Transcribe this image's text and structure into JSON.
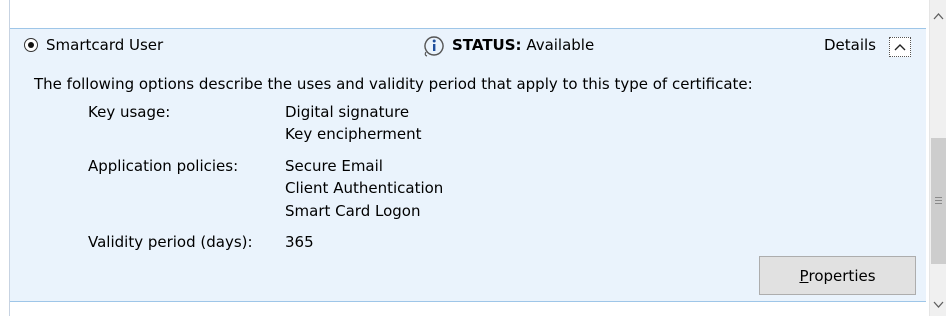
{
  "template": {
    "name": "Smartcard User",
    "status_label": "STATUS:",
    "status_value": "Available",
    "details_label": "Details",
    "description": "The following options describe the uses and validity period that apply to this type of certificate:",
    "key_usage_label": "Key usage:",
    "key_usage_values": [
      "Digital signature",
      "Key encipherment"
    ],
    "app_policies_label": "Application policies:",
    "app_policies_values": [
      "Secure Email",
      "Client Authentication",
      "Smart Card Logon"
    ],
    "validity_label": "Validity period (days):",
    "validity_value": "365",
    "properties_button": {
      "accelerator": "P",
      "rest": "roperties"
    }
  },
  "icons": {
    "status": "info-icon",
    "details_toggle": "chevron-up-icon",
    "scroll_up": "chevron-up-icon",
    "scroll_down": "chevron-down-icon"
  },
  "colors": {
    "panel_background": "#eaf3fc",
    "panel_border": "#9ec6e8",
    "button_background": "#e1e1e1"
  }
}
